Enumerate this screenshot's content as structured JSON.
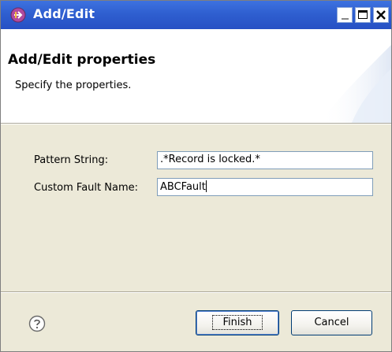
{
  "window": {
    "title": "Add/Edit",
    "icon": "wizard-icon"
  },
  "titlebar_buttons": {
    "minimize": "minimize-icon",
    "maximize": "maximize-icon",
    "close": "close-icon"
  },
  "banner": {
    "title": "Add/Edit properties",
    "description": "Specify the properties."
  },
  "form": {
    "pattern_string_label": "Pattern String:",
    "pattern_string_value": ".*Record is locked.*",
    "custom_fault_name_label": "Custom Fault Name:",
    "custom_fault_name_value": "ABCFault"
  },
  "footer": {
    "help_icon": "help-icon",
    "finish_label": "Finish",
    "cancel_label": "Cancel"
  },
  "colors": {
    "titlebar": "#2f5fd0",
    "dialog_background": "#ece9d8",
    "banner_background": "#ffffff",
    "accent": "#3d72e0"
  }
}
